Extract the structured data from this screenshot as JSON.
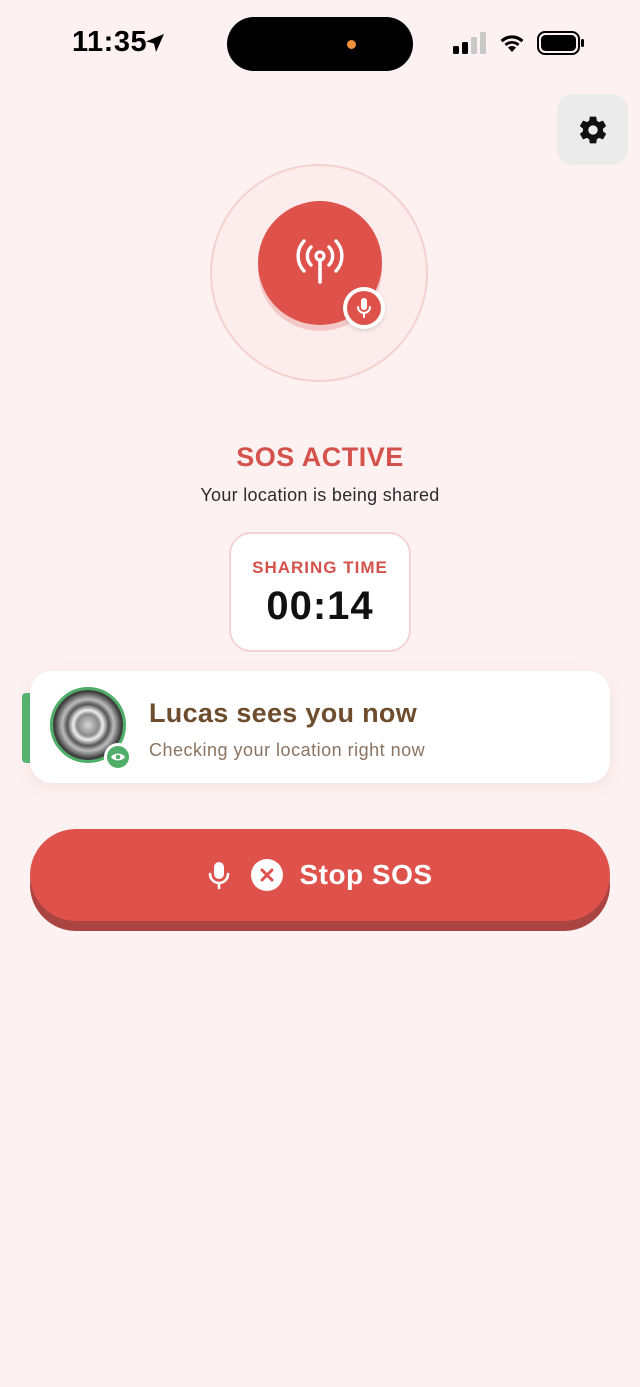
{
  "status_bar": {
    "time": "11:35"
  },
  "colors": {
    "accent_red": "#df524c",
    "viewer_green": "#4fae68",
    "background": "#fdf1f1",
    "title_brown": "#6e4d2e"
  },
  "icons": {
    "settings": "gear-icon",
    "broadcast": "broadcast-icon",
    "mic": "microphone-icon",
    "eye": "eye-icon",
    "close": "close-circle-icon"
  },
  "sos": {
    "title": "SOS ACTIVE",
    "subtitle": "Your location is being shared"
  },
  "timer": {
    "label": "SHARING TIME",
    "value": "00:14"
  },
  "viewer": {
    "title": "Lucas sees you now",
    "subtitle": "Checking your location right now"
  },
  "stop_button": {
    "label": "Stop SOS"
  }
}
